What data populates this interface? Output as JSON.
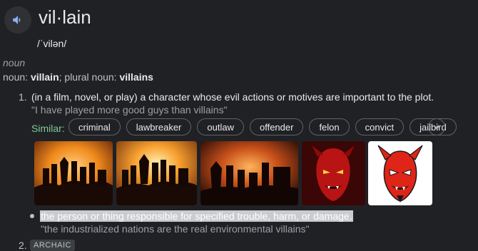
{
  "entry": {
    "headword": "vil·lain",
    "phonetic": "/ˈvilən/",
    "part_of_speech": "noun",
    "noun_label": "noun:",
    "noun_value": "villain",
    "plural_label": "plural noun:",
    "plural_value": "villains"
  },
  "sense1": {
    "number": "1.",
    "definition": "(in a film, novel, or play) a character whose evil actions or motives are important to the plot.",
    "example": "\"I have played more good guys than villains\"",
    "similar_label": "Similar:",
    "similar": [
      "criminal",
      "lawbreaker",
      "outlaw",
      "offender",
      "felon",
      "convict",
      "jailbird"
    ]
  },
  "images": [
    {
      "icon": "villain-silhouettes-sunset-1"
    },
    {
      "icon": "villain-silhouettes-sunset-2"
    },
    {
      "icon": "villain-silhouettes-sunset-3"
    },
    {
      "icon": "red-devil-face-dark"
    },
    {
      "icon": "red-devil-face-light"
    }
  ],
  "sense1b": {
    "definition": "the person or thing responsible for specified trouble, harm, or damage.",
    "example": "\"the industrialized nations are the real environmental villains\""
  },
  "sense2": {
    "number": "2.",
    "tag": "ARCHAIC"
  },
  "colors": {
    "background": "#202124",
    "similar_label": "#81c995",
    "highlight": "#c9cbce"
  }
}
